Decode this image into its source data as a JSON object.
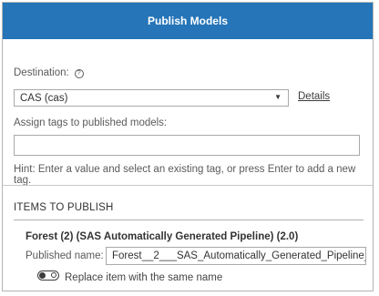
{
  "dialog": {
    "title": "Publish Models"
  },
  "destination": {
    "label": "Destination:",
    "help_icon": "?",
    "selected": "CAS (cas)",
    "details_link": "Details"
  },
  "tags": {
    "label": "Assign tags to published models:",
    "value": "",
    "hint": "Hint: Enter a value and select an existing tag, or press Enter to add a new tag."
  },
  "items": {
    "section_title": "ITEMS TO PUBLISH",
    "list": [
      {
        "title": "Forest (2) (SAS Automatically Generated Pipeline) (2.0)",
        "published_name_label": "Published name:",
        "published_name_value": "Forest__2___SAS_Automatically_Generated_Pipeline_",
        "replace_label": "Replace item with the same name",
        "replace_enabled": false
      }
    ]
  },
  "colors": {
    "title_bar": "#2575b8"
  }
}
